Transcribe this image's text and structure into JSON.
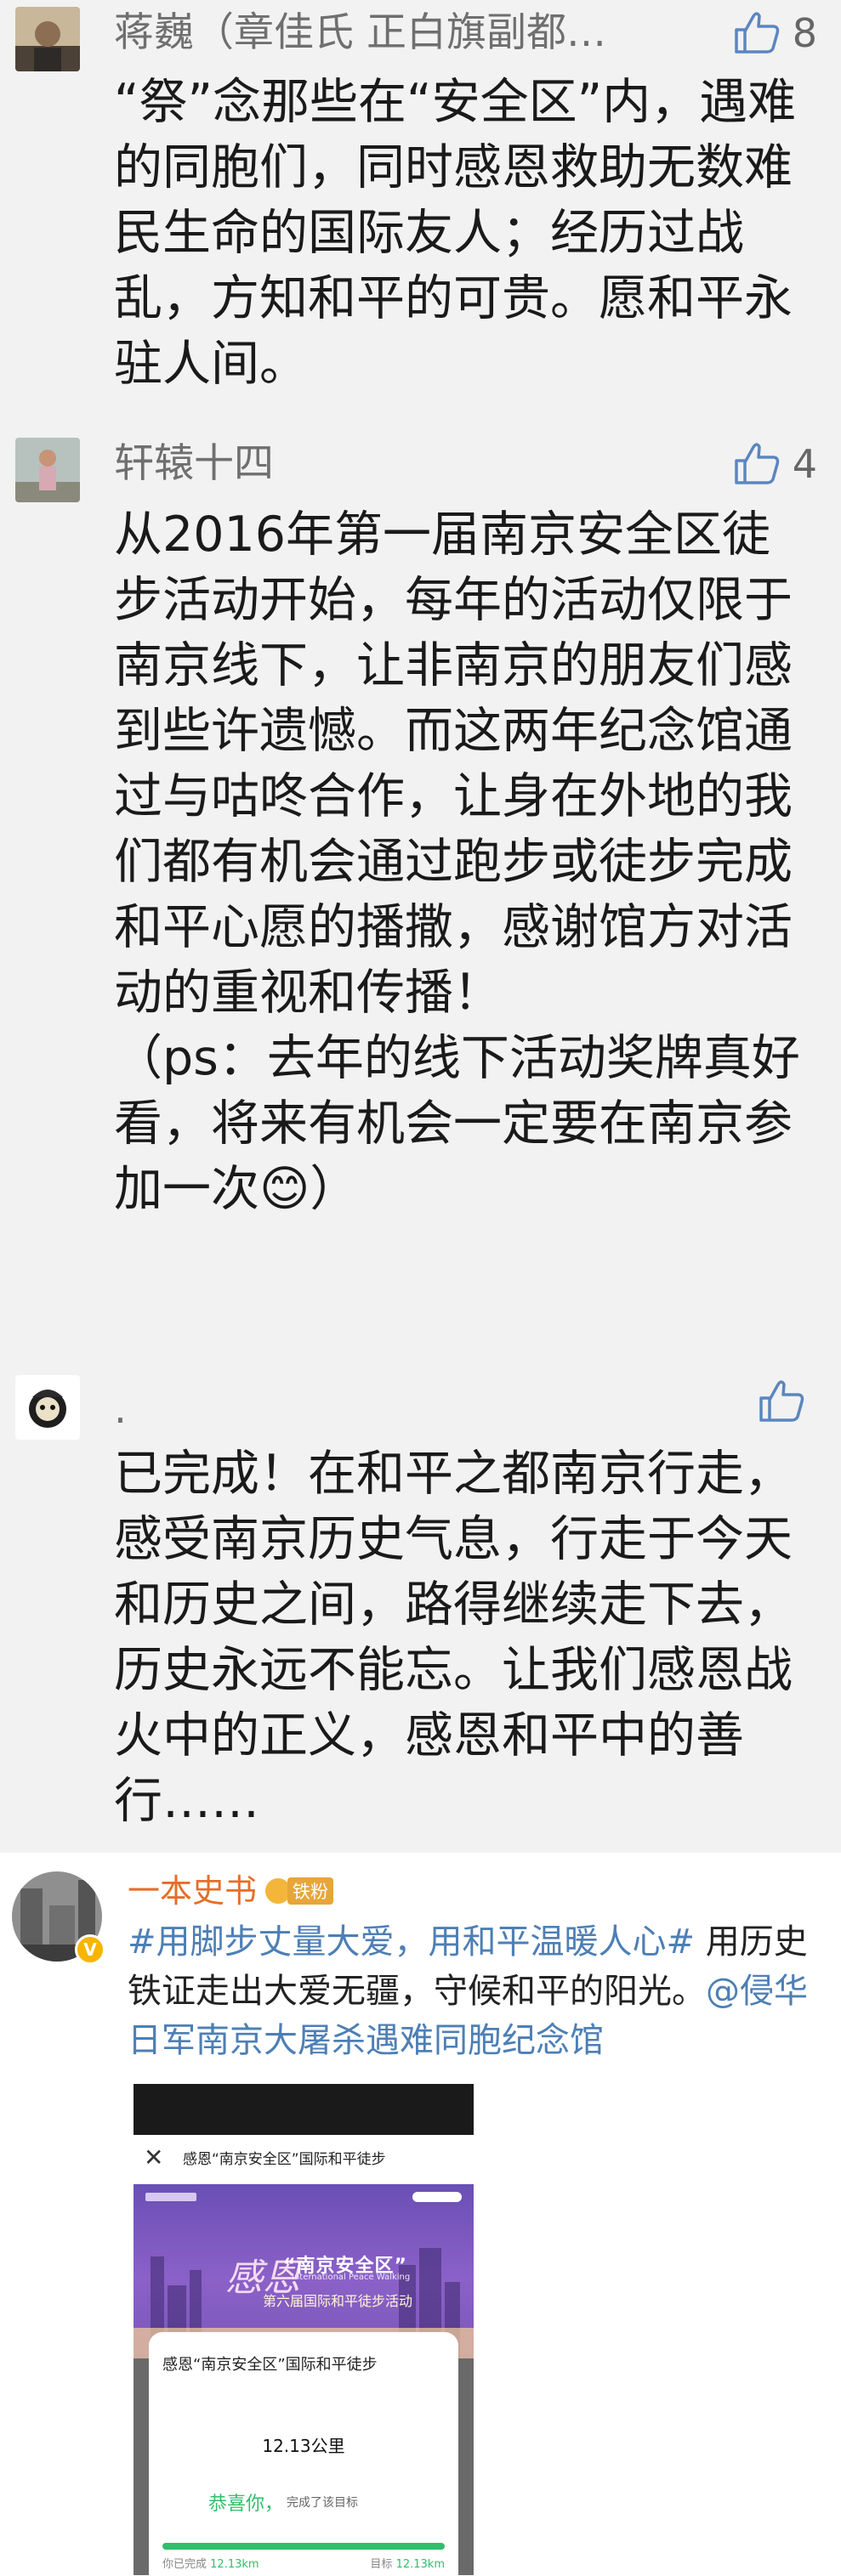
{
  "comments": [
    {
      "user": "蒋巍（章佳氏 正白旗副都…",
      "likes": "8",
      "text": "“祭”念那些在“安全区”内，遇难的同胞们，同时感恩救助无数难民生命的国际友人；经历过战乱，方知和平的可贵。愿和平永驻人间。"
    },
    {
      "user": "轩辕十四",
      "likes": "4",
      "text": "从2016年第一届南京安全区徒步活动开始，每年的活动仅限于南京线下，让非南京的朋友们感到些许遗憾。而这两年纪念馆通过与咕咚合作，让身在外地的我们都有机会通过跑步或徒步完成和平心愿的播撒，感谢馆方对活动的重视和传播！\n（ps：去年的线下活动奖牌真好看，将来有机会一定要在南京参加一次😊）"
    },
    {
      "user": ".",
      "likes": "",
      "text": "已完成！在和平之都南京行走，感受南京历史气息，行走于今天和历史之间，路得继续走下去，历史永远不能忘。让我们感恩战火中的正义，感恩和平中的善行……"
    }
  ],
  "post": {
    "user": "一本史书",
    "fan_badge": "铁粉",
    "verified_badge": "V",
    "topic": "#用脚步丈量大爱，用和平温暖人心#",
    "text": " 用历史铁证走出大爱无疆，守候和平的阳光。",
    "mention": "@侵华日军南京大屠杀遇难同胞纪念馆"
  },
  "screenshot": {
    "close": "✕",
    "title": "感恩“南京安全区”国际和平徒步",
    "banner_big": "感恩",
    "banner_main": "“南京安全区”",
    "banner_sub": "International Peace Walking",
    "banner_line": "第六届国际和平徒步活动",
    "card_title": "感恩“南京安全区”国际和平徒步",
    "distance": "12.13公里",
    "congrats": "恭喜你，",
    "done": "完成了该目标",
    "progress_fraction": 1.0,
    "completed_label": "你已完成",
    "completed_value": "12.13km",
    "goal_label": "目标",
    "goal_value": "12.13km"
  },
  "colors": {
    "accent": "#e46e28",
    "link": "#4d7fb5",
    "success": "#2fbf6a"
  }
}
